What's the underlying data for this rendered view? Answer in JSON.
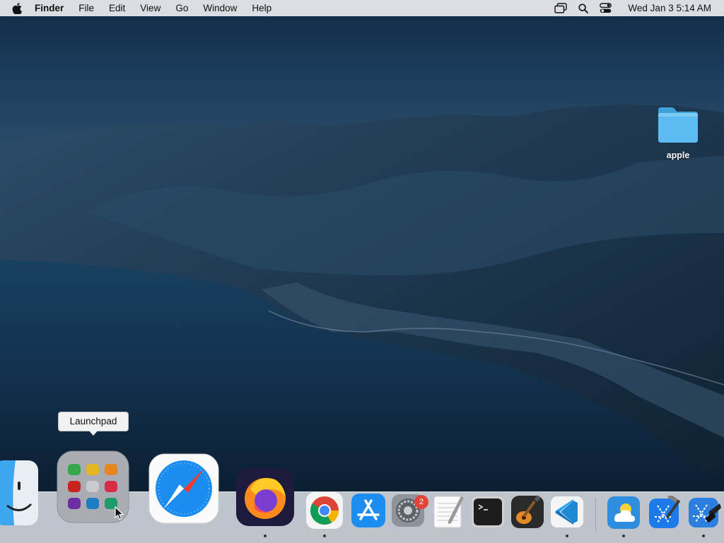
{
  "menubar": {
    "app_name": "Finder",
    "items": [
      "File",
      "Edit",
      "View",
      "Go",
      "Window",
      "Help"
    ],
    "clock": "Wed Jan 3  5:14 AM"
  },
  "desktop": {
    "icons": [
      {
        "label": "apple",
        "icon": "folder-icon"
      }
    ]
  },
  "tooltip": {
    "text": "Launchpad"
  },
  "dock": {
    "items": [
      {
        "name": "Finder",
        "icon": "finder-icon",
        "running": false
      },
      {
        "name": "Launchpad",
        "icon": "launchpad-icon",
        "running": false
      },
      {
        "name": "Safari",
        "icon": "safari-icon",
        "running": false
      },
      {
        "name": "Firefox",
        "icon": "firefox-icon",
        "running": true
      },
      {
        "name": "Google Chrome",
        "icon": "chrome-icon",
        "running": true
      },
      {
        "name": "App Store",
        "icon": "app-store-icon",
        "running": false
      },
      {
        "name": "System Preferences",
        "icon": "system-preferences-icon",
        "running": false,
        "badge": "2"
      },
      {
        "name": "TextEdit",
        "icon": "textedit-icon",
        "running": false
      },
      {
        "name": "Terminal",
        "icon": "terminal-icon",
        "running": false
      },
      {
        "name": "GarageBand",
        "icon": "garageband-icon",
        "running": false
      },
      {
        "name": "Visual Studio Code",
        "icon": "vscode-icon",
        "running": true
      },
      {
        "name": "Weather",
        "icon": "weather-icon",
        "running": true
      },
      {
        "name": "Xcode",
        "icon": "xcode-icon",
        "running": false
      },
      {
        "name": "Xcode Instruments",
        "icon": "instruments-icon",
        "running": true
      }
    ]
  },
  "colors": {
    "menubar_bg": "#dadde2",
    "folder_blue": "#4fb3ec",
    "badge_red": "#e2443a"
  }
}
